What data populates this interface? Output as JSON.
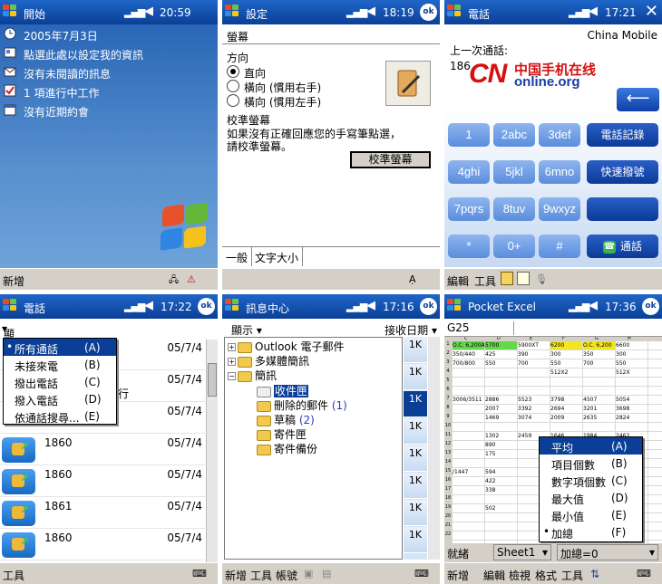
{
  "status": {
    "signal": "▂▄▆",
    "volume": "◀€"
  },
  "home": {
    "title": "開始",
    "time": "20:59",
    "rows": [
      {
        "text": "2005年7月3日",
        "icon": "clock-icon"
      },
      {
        "text": "點選此處以設定我的資訊",
        "icon": "owner-card-icon"
      },
      {
        "text": "沒有未閱讀的訊息",
        "icon": "envelope-icon"
      },
      {
        "text": "1 項進行中工作",
        "icon": "tasks-icon"
      },
      {
        "text": "沒有近期約會",
        "icon": "calendar-icon"
      }
    ],
    "bottom": {
      "new": "新增"
    }
  },
  "settings": {
    "title": "設定",
    "time": "18:19",
    "ok": "ok",
    "header": "螢幕",
    "orientation_label": "方向",
    "options": [
      "直向",
      "橫向 (慣用右手)",
      "橫向 (慣用左手)"
    ],
    "calib_title": "校準螢幕",
    "calib_text_1": "如果沒有正確回應您的手寫筆點選，",
    "calib_text_2": "請校準螢幕。",
    "calib_button": "校準螢幕",
    "tabs": [
      "一般",
      "文字大小"
    ]
  },
  "dialer": {
    "title": "電話",
    "time": "17:21",
    "carrier": "China Mobile",
    "last_call_label": "上一次通話:",
    "last_call_number": "186",
    "logo_cn": "CN",
    "logo_chinese": "中国手机在线",
    "logo_online": "online.org",
    "keys": [
      [
        "1",
        "2abc",
        "3def"
      ],
      [
        "4ghi",
        "5jkl",
        "6mno"
      ],
      [
        "7pqrs",
        "8tuv",
        "9wxyz"
      ],
      [
        "*",
        "0+",
        "#"
      ]
    ],
    "side_keys": [
      "電話記錄",
      "快速撥號",
      "",
      "通話"
    ],
    "bottom": {
      "edit": "編輯",
      "tools": "工具"
    }
  },
  "calllog": {
    "title": "電話",
    "time": "17:22",
    "show_label": "顯示",
    "menu": [
      {
        "label": "所有通話",
        "shortcut": "(A)"
      },
      {
        "label": "未接來電",
        "shortcut": "(B)"
      },
      {
        "label": "撥出電話",
        "shortcut": "(C)"
      },
      {
        "label": "撥入電話",
        "shortcut": "(D)"
      },
      {
        "label": "依通話搜尋...",
        "shortcut": "(E)"
      }
    ],
    "partial_text": "行",
    "rows": [
      {
        "name": "",
        "date": "05/7/4"
      },
      {
        "name": "",
        "date": "05/7/4"
      },
      {
        "name": "",
        "date": "05/7/4"
      },
      {
        "name": "1860",
        "date": "05/7/4"
      },
      {
        "name": "1860",
        "date": "05/7/4"
      },
      {
        "name": "1861",
        "date": "05/7/4"
      },
      {
        "name": "1860",
        "date": "05/7/4"
      }
    ],
    "bottom": {
      "tools": "工具"
    }
  },
  "messaging": {
    "title": "訊息中心",
    "time": "17:16",
    "show_label": "顯示",
    "sort_label": "接收日期",
    "tree": [
      {
        "label": "Outlook 電子郵件",
        "count": ""
      },
      {
        "label": "多媒體簡訊",
        "count": ""
      },
      {
        "label": "簡訊",
        "count": ""
      },
      {
        "label": "收件匣",
        "count": ""
      },
      {
        "label": "刪除的郵件",
        "count": "(1)"
      },
      {
        "label": "草稿",
        "count": "(2)"
      },
      {
        "label": "寄件匣",
        "count": ""
      },
      {
        "label": "寄件備份",
        "count": ""
      }
    ],
    "sizes": [
      "1K",
      "1K",
      "1K",
      "1K",
      "1K",
      "1K",
      "1K",
      "1K"
    ],
    "bottom": {
      "new": "新增",
      "tools": "工具",
      "account": "帳號"
    }
  },
  "excel": {
    "title": "Pocket Excel",
    "time": "17:36",
    "cell_ref": "G25",
    "columns": [
      "C",
      "D",
      "E",
      "F",
      "G",
      "H"
    ],
    "rows_visible": [
      "1",
      "2",
      "3",
      "4",
      "5",
      "6",
      "7",
      "8",
      "9",
      "10",
      "11",
      "12",
      "13",
      "14",
      "15",
      "16",
      "17",
      "18",
      "19",
      "20",
      "21",
      "22"
    ],
    "cells": [
      [
        "O.C. 6,200A",
        "5700",
        "5900XT",
        "6200",
        "O.C. 6,200",
        "6600"
      ],
      [
        "350/440",
        "425",
        "390",
        "300",
        "350",
        "300"
      ],
      [
        "700/800",
        "550",
        "700",
        "550",
        "700",
        "550"
      ],
      [
        "",
        "",
        "",
        "512X2",
        "",
        "512X"
      ],
      [
        "3006/3511",
        "2886",
        "5523",
        "3798",
        "4507",
        "5054"
      ],
      [
        "",
        "2007",
        "3392",
        "2694",
        "3201",
        "3698"
      ],
      [
        "",
        "1469",
        "3074",
        "2009",
        "2635",
        "2824"
      ],
      [
        "",
        "1302",
        "2459",
        "1646",
        "1984",
        "2462"
      ],
      [
        "",
        "890",
        "",
        "",
        "",
        "25"
      ],
      [
        "",
        "175",
        "",
        "",
        "",
        "47"
      ],
      [
        "/1447",
        "594",
        "",
        "",
        "",
        "99"
      ],
      [
        "",
        "422",
        "",
        "",
        "",
        "76"
      ],
      [
        "",
        "338",
        "",
        "",
        "",
        "59"
      ],
      [
        "",
        "502",
        "",
        "",
        "",
        "67"
      ]
    ],
    "context_menu": [
      {
        "label": "平均",
        "shortcut": "(A)"
      },
      {
        "label": "項目個數",
        "shortcut": "(B)"
      },
      {
        "label": "數字項個數",
        "shortcut": "(C)"
      },
      {
        "label": "最大值",
        "shortcut": "(D)"
      },
      {
        "label": "最小值",
        "shortcut": "(E)"
      },
      {
        "label": "加總",
        "shortcut": "(F)"
      }
    ],
    "status_ready": "就緒",
    "sheet": "Sheet1",
    "sum": "加總=0",
    "bottom": {
      "new": "新增",
      "edit": "編輯",
      "view": "檢視",
      "format": "格式",
      "tools": "工具"
    }
  }
}
